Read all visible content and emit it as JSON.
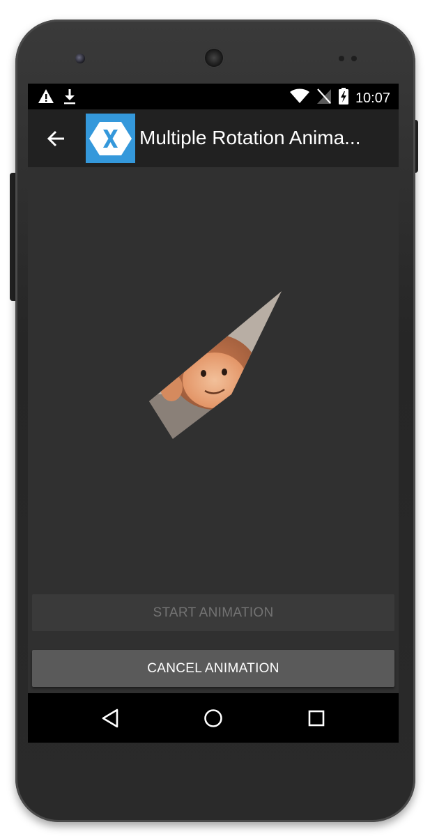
{
  "status_bar": {
    "time": "10:07",
    "left_icons": [
      "warning-icon",
      "download-icon"
    ],
    "right_icons": [
      "wifi-icon",
      "no-sim-icon",
      "battery-charging-icon"
    ]
  },
  "toolbar": {
    "back_icon": "arrow-left-icon",
    "logo_icon": "xamarin-logo-icon",
    "title": "Multiple Rotation Anima..."
  },
  "content": {
    "image_description_icon": "monkey-image"
  },
  "buttons": {
    "start_label": "START ANIMATION",
    "cancel_label": "CANCEL ANIMATION"
  },
  "navigation": {
    "back_icon": "nav-back-icon",
    "home_icon": "nav-home-icon",
    "recents_icon": "nav-recents-icon"
  },
  "colors": {
    "toolbar_bg": "#212121",
    "screen_bg": "#303030",
    "logo_blue": "#3498db",
    "button_disabled_bg": "#3a3a3a",
    "button_enabled_bg": "#5a5a5a"
  }
}
